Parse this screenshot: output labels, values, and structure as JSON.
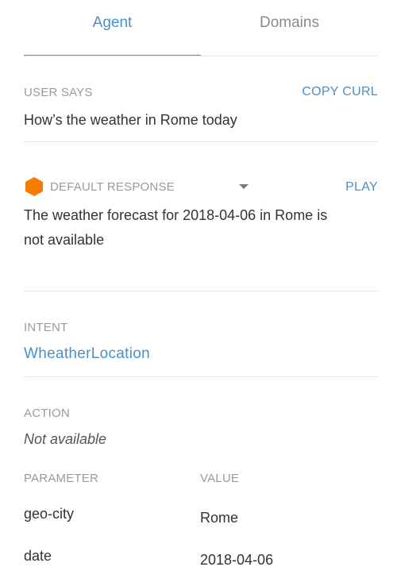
{
  "tabs": [
    {
      "label": "Agent",
      "active": true
    },
    {
      "label": "Domains",
      "active": false
    }
  ],
  "user_says": {
    "label": "USER SAYS",
    "copy_curl": "COPY CURL",
    "text": "How’s the weather in Rome today"
  },
  "response": {
    "icon": "hexagon-icon",
    "icon_color": "#f57c00",
    "label": "DEFAULT RESPONSE",
    "play": "PLAY",
    "text_line1": "The weather forecast for 2018-04-06 in Rome is",
    "text_line2": "not available"
  },
  "intent": {
    "label": "INTENT",
    "value": "WheatherLocation"
  },
  "action": {
    "label": "ACTION",
    "value": "Not available"
  },
  "parameters": {
    "header_param": "PARAMETER",
    "header_value": "VALUE",
    "rows": [
      {
        "name": "geo-city",
        "value": "Rome"
      },
      {
        "name": "date",
        "value": "2018-04-06"
      }
    ]
  },
  "colors": {
    "accent": "#4a90c8",
    "muted": "#9a9a9a",
    "response_icon": "#f57c00"
  }
}
